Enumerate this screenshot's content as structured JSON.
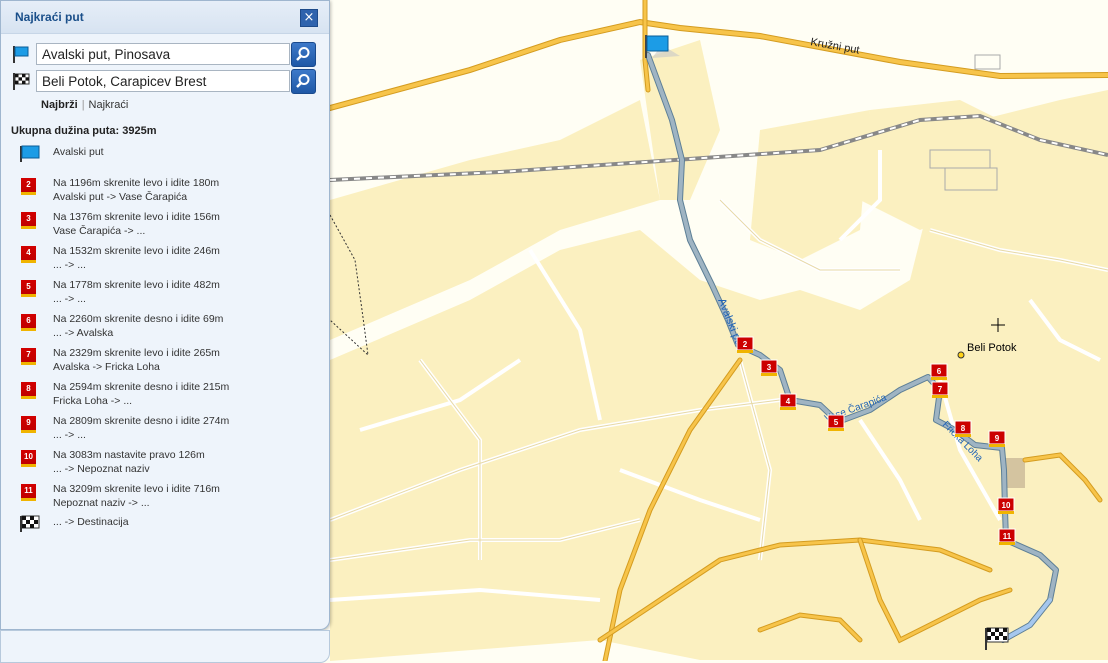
{
  "panel": {
    "title": "Najkraći put",
    "close_symbol": "×",
    "start_value": "Avalski put, Pinosava",
    "end_value": "Beli Potok, Carapicev Brest",
    "mode_fastest": "Najbrži",
    "mode_shortest": "Najkraći",
    "mode_separator": "|",
    "total": "Ukupna dužina puta: 3925m"
  },
  "start_step": {
    "label": "Avalski put",
    "icon": "blue-flag-icon"
  },
  "steps": [
    {
      "num": "2",
      "line1": "Na 1196m skrenite levo i idite 180m",
      "line2": "Avalski put -> Vase Čarapića"
    },
    {
      "num": "3",
      "line1": "Na 1376m skrenite levo i idite 156m",
      "line2": "Vase Čarapića -> ..."
    },
    {
      "num": "4",
      "line1": "Na 1532m skrenite levo i idite 246m",
      "line2": "... -> ..."
    },
    {
      "num": "5",
      "line1": "Na 1778m skrenite levo i idite 482m",
      "line2": "... -> ..."
    },
    {
      "num": "6",
      "line1": "Na 2260m skrenite desno i idite 69m",
      "line2": "... -> Avalska"
    },
    {
      "num": "7",
      "line1": "Na 2329m skrenite levo i idite 265m",
      "line2": "Avalska -> Fricka Loha"
    },
    {
      "num": "8",
      "line1": "Na 2594m skrenite desno i idite 215m",
      "line2": "Fricka Loha -> ..."
    },
    {
      "num": "9",
      "line1": "Na 2809m skrenite desno i idite 274m",
      "line2": "... -> ..."
    },
    {
      "num": "10",
      "line1": "Na 3083m nastavite pravo 126m",
      "line2": "... -> Nepoznat naziv"
    },
    {
      "num": "11",
      "line1": "Na 3209m skrenite levo i idite 716m",
      "line2": "Nepoznat naziv -> ..."
    }
  ],
  "end_step": {
    "label": "... -> Destinacija",
    "icon": "checkered-flag-icon"
  },
  "map": {
    "road_kruzni": "Kružni put",
    "road_avalski": "Avalski put",
    "road_carapica": "Vase Čarapića",
    "road_fricka": "Fricka Loha",
    "poi_beli_potok": "Beli Potok",
    "markers": [
      "2",
      "3",
      "4",
      "5",
      "6",
      "7",
      "8",
      "9",
      "10",
      "11"
    ],
    "colors": {
      "route": "#7f97a8",
      "main_road": "#f0b030",
      "area": "#fbf0c0",
      "panel_title": "#1a4f8a",
      "marker": "#cc0000"
    }
  }
}
